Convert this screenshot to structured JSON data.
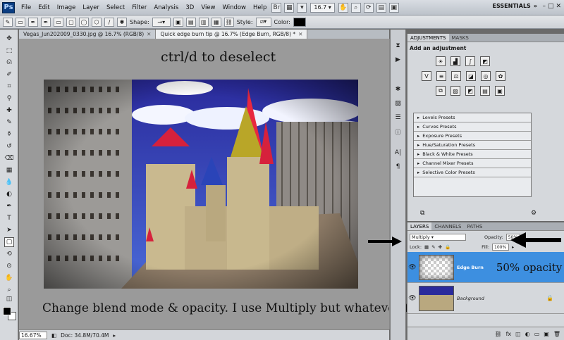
{
  "menu": {
    "items": [
      "File",
      "Edit",
      "Image",
      "Layer",
      "Select",
      "Filter",
      "Analysis",
      "3D",
      "View",
      "Window",
      "Help"
    ],
    "zoom": "16.7",
    "workspace": "ESSENTIALS"
  },
  "options": {
    "shape_label": "Shape:",
    "style_label": "Style:",
    "color_label": "Color:"
  },
  "tabs": [
    {
      "label": "Vegas_Jun202009_0330.jpg @ 16.7% (RGB/8)"
    },
    {
      "label": "Quick edge burn tip @ 16.7% (Edge Burn, RGB/8) *"
    }
  ],
  "captions": {
    "top": "ctrl/d to deselect",
    "bottom": "Change blend mode & opacity.  I use Multiply but whatever floats your boat",
    "opacity_note": "50% opacity"
  },
  "status": {
    "zoom": "16.67%",
    "doc": "Doc: 34.8M/70.4M"
  },
  "adjustments": {
    "tabs": [
      "ADJUSTMENTS",
      "MASKS"
    ],
    "title": "Add an adjustment",
    "presets": [
      "Levels Presets",
      "Curves Presets",
      "Exposure Presets",
      "Hue/Saturation Presets",
      "Black & White Presets",
      "Channel Mixer Presets",
      "Selective Color Presets"
    ]
  },
  "layers_panel": {
    "tabs": [
      "LAYERS",
      "CHANNELS",
      "PATHS"
    ],
    "blend_mode": "Multiply",
    "opacity_label": "Opacity:",
    "opacity": "50%",
    "lock_label": "Lock:",
    "fill_label": "Fill:",
    "fill": "100%",
    "layers": [
      {
        "name": "Edge Burn"
      },
      {
        "name": "Background"
      }
    ]
  },
  "colors": {
    "accent": "#3d8fe0"
  }
}
